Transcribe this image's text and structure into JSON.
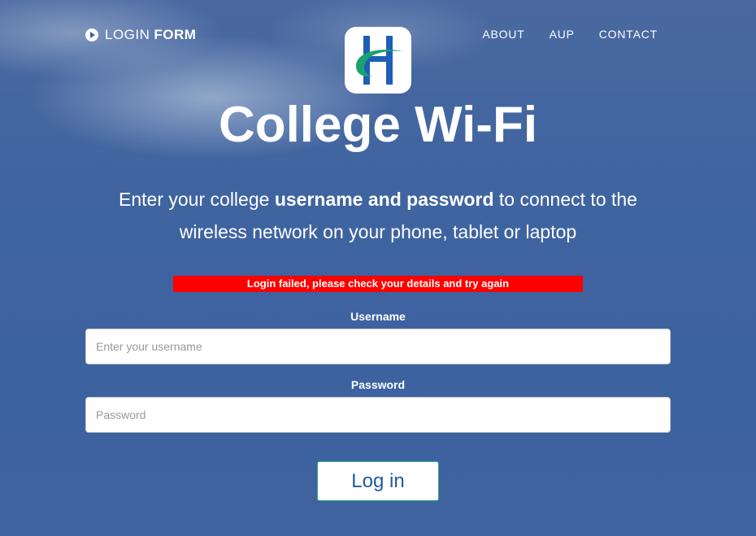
{
  "header": {
    "brand_part1": "LOGIN",
    "brand_part2": "FORM",
    "nav": [
      "ABOUT",
      "AUP",
      "CONTACT"
    ]
  },
  "logo": {
    "icon": "college-h-logo-icon",
    "colors": {
      "blue": "#1d5fb8",
      "green": "#1aa36b"
    }
  },
  "hero": {
    "title": "College Wi-Fi",
    "intro_pre": "Enter your college ",
    "intro_bold": "username and password",
    "intro_post": " to connect to the wireless network on your phone, tablet or laptop"
  },
  "form": {
    "error": "Login failed, please check your details and try again",
    "username_label": "Username",
    "username_placeholder": "Enter your username",
    "password_label": "Password",
    "password_placeholder": "Password",
    "submit_label": "Log in"
  },
  "colors": {
    "background": "#3f64a0",
    "error_bg": "#ff0000",
    "button_text": "#1c5b9e",
    "button_border": "#2aa68a"
  }
}
